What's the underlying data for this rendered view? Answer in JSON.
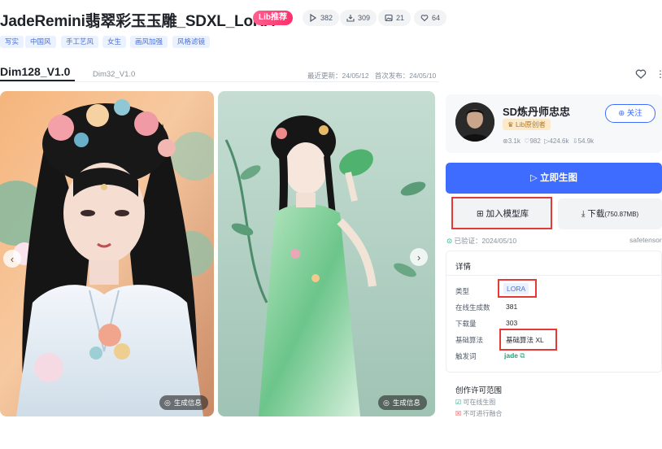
{
  "header": {
    "title": "JadeRemini翡翠彩玉玉雕_SDXL_LoRA",
    "badge": "Lib推荐",
    "stats": {
      "runs": "382",
      "downloads": "309",
      "images": "21",
      "likes": "64"
    },
    "tags": [
      "写实",
      "中国风",
      "手工艺风",
      "女生",
      "画风加强",
      "风格滤镜"
    ]
  },
  "versions": {
    "active": "Dim128_V1.0",
    "inactive": "Dim32_V1.0",
    "updated": "最近更新：24/05/12",
    "published": "首次发布：24/05/10"
  },
  "gallery": {
    "gen_info_label": "生成信息"
  },
  "author": {
    "name": "SD炼丹师忠忠",
    "badge": "Lib原创者",
    "stats": {
      "followers": "3.1k",
      "likes": "982",
      "views": "424.6k",
      "downloads": "54.9k"
    },
    "follow_label": "关注"
  },
  "actions": {
    "generate": "立即生图",
    "add_to_library": "加入模型库",
    "download": "下载",
    "download_size": "(750.87MB)"
  },
  "verification": {
    "verified": "已验证：2024/05/10",
    "format": "safetensors"
  },
  "details": {
    "title": "详情",
    "rows": [
      {
        "label": "类型",
        "value": "LORA"
      },
      {
        "label": "在线生成数",
        "value": "381"
      },
      {
        "label": "下载量",
        "value": "303"
      },
      {
        "label": "基础算法",
        "value": "基础算法 XL"
      },
      {
        "label": "触发词",
        "value": "jade"
      }
    ]
  },
  "license": {
    "title": "创作许可范围",
    "items": [
      "可在线生图",
      "不可进行融合"
    ]
  },
  "colors": {
    "primary": "#3d6cff",
    "highlight": "#e53935",
    "tag_bg": "#eaf1ff",
    "tag_text": "#4a6fd9",
    "badge": "#ff2f6b"
  }
}
